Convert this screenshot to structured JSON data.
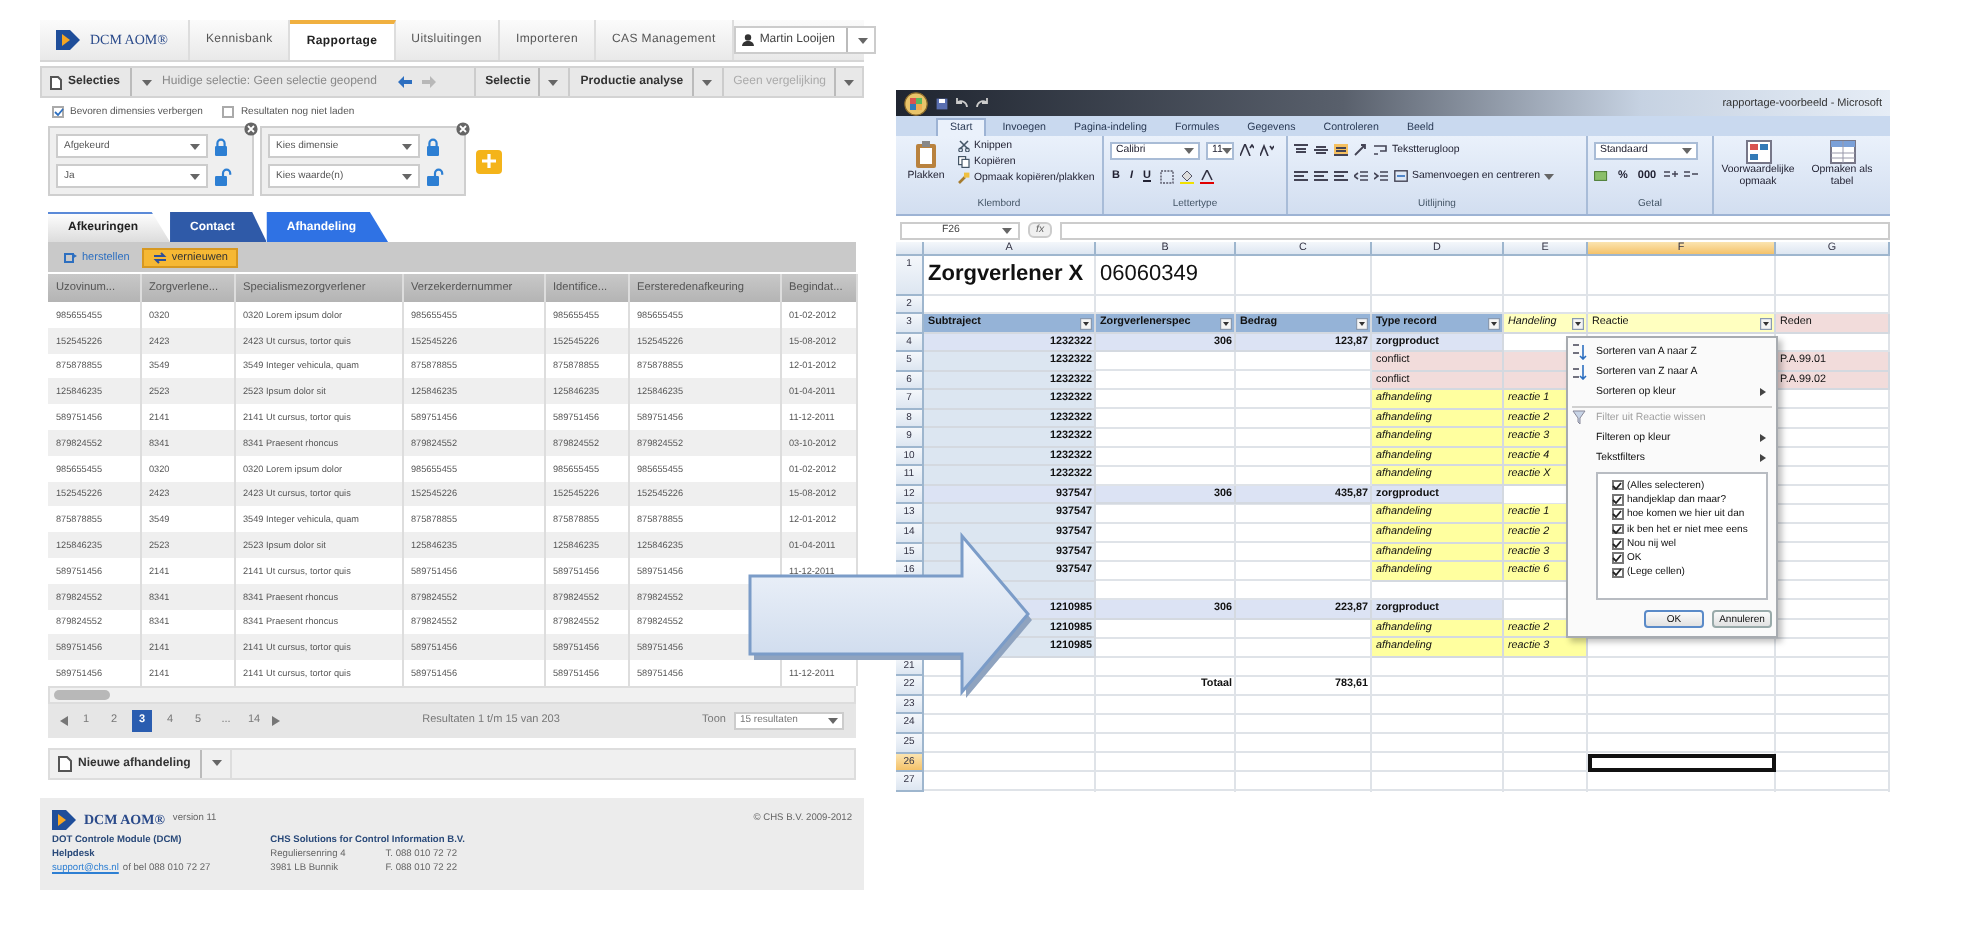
{
  "portal": {
    "logo": {
      "text": "DCM AOM®"
    },
    "nav_tabs": [
      {
        "label": "Kennisbank",
        "selected": false
      },
      {
        "label": "Rapportage",
        "selected": true
      },
      {
        "label": "Uitsluitingen",
        "selected": false
      },
      {
        "label": "Importeren",
        "selected": false
      },
      {
        "label": "CAS Management",
        "selected": false
      }
    ],
    "user_menu": {
      "label": "Martin Looijen"
    },
    "toolbar": {
      "selections_button": "Selecties",
      "current_selection": "Huidige selectie: Geen selectie geopend",
      "menus": [
        {
          "label": "Selectie",
          "disabled": false
        },
        {
          "label": "Productie analyse",
          "disabled": false
        },
        {
          "label": "Geen vergelijking",
          "disabled": true
        }
      ]
    },
    "options": [
      {
        "label": "Bevoren dimensies verbergen",
        "checked": true
      },
      {
        "label": "Resultaten nog niet laden",
        "checked": false
      }
    ],
    "filters": [
      {
        "fields": [
          {
            "text": "Afgekeurd",
            "locked": true
          },
          {
            "text": "Ja",
            "locked": false
          }
        ]
      },
      {
        "fields": [
          {
            "text": "Kies dimensie",
            "locked": true
          },
          {
            "text": "Kies waarde(n)",
            "locked": false
          }
        ]
      }
    ],
    "view_tabs": [
      {
        "label": "Afkeuringen",
        "selected": true
      },
      {
        "label": "Contact",
        "selected": false
      },
      {
        "label": "Afhandeling",
        "selected": false
      }
    ],
    "actions": [
      {
        "label": "herstellen",
        "kind": "link"
      },
      {
        "label": "vernieuwen",
        "kind": "button"
      }
    ],
    "table": {
      "columns": [
        "Uzovinum...",
        "Zorgverlene...",
        "Specialismezorgverlener",
        "Verzekerdernummer",
        "Identifice...",
        "Eersteredenafkeuring",
        "Begindat..."
      ],
      "rows": [
        [
          "985655455",
          "0320",
          "0320 Lorem ipsum dolor",
          "985655455",
          "985655455",
          "985655455",
          "01-02-2012"
        ],
        [
          "152545226",
          "2423",
          "2423 Ut cursus, tortor quis",
          "152545226",
          "152545226",
          "152545226",
          "15-08-2012"
        ],
        [
          "875878855",
          "3549",
          "3549 Integer vehicula, quam",
          "875878855",
          "875878855",
          "875878855",
          "12-01-2012"
        ],
        [
          "125846235",
          "2523",
          "2523 Ipsum dolor sit",
          "125846235",
          "125846235",
          "125846235",
          "01-04-2011"
        ],
        [
          "589751456",
          "2141",
          "2141 Ut cursus, tortor quis",
          "589751456",
          "589751456",
          "589751456",
          "11-12-2011"
        ],
        [
          "879824552",
          "8341",
          "8341 Praesent rhoncus",
          "879824552",
          "879824552",
          "879824552",
          "03-10-2012"
        ],
        [
          "985655455",
          "0320",
          "0320 Lorem ipsum dolor",
          "985655455",
          "985655455",
          "985655455",
          "01-02-2012"
        ],
        [
          "152545226",
          "2423",
          "2423 Ut cursus, tortor quis",
          "152545226",
          "152545226",
          "152545226",
          "15-08-2012"
        ],
        [
          "875878855",
          "3549",
          "3549 Integer vehicula, quam",
          "875878855",
          "875878855",
          "875878855",
          "12-01-2012"
        ],
        [
          "125846235",
          "2523",
          "2523 Ipsum dolor sit",
          "125846235",
          "125846235",
          "125846235",
          "01-04-2011"
        ],
        [
          "589751456",
          "2141",
          "2141 Ut cursus, tortor quis",
          "589751456",
          "589751456",
          "589751456",
          "11-12-2011"
        ],
        [
          "879824552",
          "8341",
          "8341 Praesent rhoncus",
          "879824552",
          "879824552",
          "879824552"
        ],
        [
          "879824552",
          "8341",
          "8341 Praesent rhoncus",
          "879824552",
          "879824552",
          "879824552"
        ],
        [
          "589751456",
          "2141",
          "2141 Ut cursus, tortor quis",
          "589751456",
          "589751456",
          "589751456"
        ],
        [
          "589751456",
          "2141",
          "2141 Ut cursus, tortor quis",
          "589751456",
          "589751456",
          "589751456",
          "11-12-2011"
        ]
      ]
    },
    "pagination": {
      "pages": [
        {
          "label": "1",
          "selected": false
        },
        {
          "label": "2",
          "selected": false
        },
        {
          "label": "3",
          "selected": true
        },
        {
          "label": "4",
          "selected": false
        },
        {
          "label": "5",
          "selected": false
        },
        {
          "label": "...",
          "selected": false
        },
        {
          "label": "14",
          "selected": false
        }
      ],
      "summary": "Resultaten 1 t/m 15 van 203",
      "show_label": "Toon",
      "page_size": "15 resultaten"
    },
    "new_button": {
      "label": "Nieuwe afhandeling"
    },
    "footer": {
      "logo": "DCM AOM®",
      "version": "version 11",
      "copyright": "© CHS B.V. 2009-2012",
      "product": "DOT Controle Module (DCM)",
      "helpdesk": "Helpdesk",
      "email": "support@chs.nl",
      "phone_text": "of bel 088 010 72 27",
      "company": "CHS Solutions for Control Information B.V.",
      "address": [
        "Reguliersenring 4",
        "3981 LB Bunnik"
      ],
      "phones": [
        "T. 088 010 72 72",
        "F. 088 010 72 22"
      ]
    }
  },
  "spreadsheet": {
    "title": "rapportage-voorbeeld - Microsoft",
    "ribbon_tabs": [
      {
        "label": "Start",
        "selected": true
      },
      {
        "label": "Invoegen",
        "selected": false
      },
      {
        "label": "Pagina-indeling",
        "selected": false
      },
      {
        "label": "Formules",
        "selected": false
      },
      {
        "label": "Gegevens",
        "selected": false
      },
      {
        "label": "Controleren",
        "selected": false
      },
      {
        "label": "Beeld",
        "selected": false
      }
    ],
    "clipboard": {
      "paste": "Plakken",
      "commands": [
        "Knippen",
        "Kopiëren",
        "Opmaak kopiëren/plakken"
      ],
      "label": "Klembord"
    },
    "font": {
      "name": "Calibri",
      "size": "11",
      "styles": [
        "B",
        "I",
        "U"
      ],
      "label": "Lettertype"
    },
    "alignment": {
      "wrap": "Tekstterugloop",
      "merge": "Samenvoegen en centreren",
      "label": "Uitlijning"
    },
    "number": {
      "format": "Standaard",
      "buttons": [
        "%",
        "000"
      ],
      "label": "Getal"
    },
    "styles": [
      "Voorwaardelijke opmaak",
      "Opmaken als tabel"
    ],
    "name_box": "F26",
    "function_label": "fx",
    "columns": [
      {
        "label": "A",
        "selected": false
      },
      {
        "label": "B",
        "selected": false
      },
      {
        "label": "C",
        "selected": false
      },
      {
        "label": "D",
        "selected": false
      },
      {
        "label": "E",
        "selected": false
      },
      {
        "label": "F",
        "selected": true
      },
      {
        "label": "G",
        "selected": false
      }
    ],
    "rows": [
      {
        "number": "1",
        "kind": "title",
        "selected": false,
        "cells": {
          "a": "Zorgverlener X",
          "b": "06060349"
        }
      },
      {
        "number": "2",
        "kind": "plain",
        "selected": false
      },
      {
        "number": "3",
        "kind": "header",
        "selected": false,
        "cells": {
          "a": "Subtraject",
          "b": "Zorgverlenerspec",
          "c": "Bedrag",
          "d": "Type record",
          "e": "Handeling",
          "f": "Reactie",
          "g": "Reden"
        }
      },
      {
        "number": "4",
        "kind": "product",
        "selected": false,
        "cells": {
          "a": "1232322",
          "b": "306",
          "c": "123,87",
          "d": "zorgproduct"
        }
      },
      {
        "number": "5",
        "kind": "conflict",
        "selected": false,
        "cells": {
          "a": "1232322",
          "d": "conflict",
          "g": "P.A.99.01"
        }
      },
      {
        "number": "6",
        "kind": "conflict",
        "selected": false,
        "cells": {
          "a": "1232322",
          "d": "conflict",
          "g": "P.A.99.02"
        }
      },
      {
        "number": "7",
        "kind": "handling",
        "selected": false,
        "cells": {
          "a": "1232322",
          "d": "afhandeling",
          "e": "reactie 1"
        }
      },
      {
        "number": "8",
        "kind": "handling",
        "selected": false,
        "cells": {
          "a": "1232322",
          "d": "afhandeling",
          "e": "reactie 2"
        }
      },
      {
        "number": "9",
        "kind": "handling",
        "selected": false,
        "cells": {
          "a": "1232322",
          "d": "afhandeling",
          "e": "reactie 3"
        }
      },
      {
        "number": "10",
        "kind": "handling",
        "selected": false,
        "cells": {
          "a": "1232322",
          "d": "afhandeling",
          "e": "reactie 4"
        }
      },
      {
        "number": "11",
        "kind": "handling",
        "selected": false,
        "cells": {
          "a": "1232322",
          "d": "afhandeling",
          "e": "reactie X"
        }
      },
      {
        "number": "12",
        "kind": "product",
        "selected": false,
        "cells": {
          "a": "937547",
          "b": "306",
          "c": "435,87",
          "d": "zorgproduct"
        }
      },
      {
        "number": "13",
        "kind": "handling",
        "selected": false,
        "cells": {
          "a": "937547",
          "d": "afhandeling",
          "e": "reactie 1"
        }
      },
      {
        "number": "14",
        "kind": "handling",
        "selected": false,
        "cells": {
          "a": "937547",
          "d": "afhandeling",
          "e": "reactie 2"
        }
      },
      {
        "number": "15",
        "kind": "handling",
        "selected": false,
        "cells": {
          "a": "937547",
          "d": "afhandeling",
          "e": "reactie 3"
        }
      },
      {
        "number": "16",
        "kind": "handling",
        "selected": false,
        "cells": {
          "a": "937547",
          "d": "afhandeling",
          "e": "reactie 6"
        }
      },
      {
        "kind": "spacer"
      },
      {
        "kind": "product",
        "cells": {
          "a": "1210985",
          "b": "306",
          "c": "223,87",
          "d": "zorgproduct"
        }
      },
      {
        "kind": "handling",
        "cells": {
          "a": "1210985",
          "d": "afhandeling",
          "e": "reactie 2"
        }
      },
      {
        "kind": "handling",
        "cells": {
          "a": "1210985",
          "d": "afhandeling",
          "e": "reactie 3"
        }
      },
      {
        "number": "21",
        "kind": "plain",
        "selected": false
      },
      {
        "number": "22",
        "kind": "total",
        "selected": false,
        "cells": {
          "b": "Totaal",
          "c": "783,61"
        }
      },
      {
        "number": "23",
        "kind": "plain",
        "selected": false
      },
      {
        "number": "24",
        "kind": "plain",
        "selected": false
      },
      {
        "number": "25",
        "kind": "plain",
        "selected": false
      },
      {
        "number": "26",
        "kind": "plain",
        "selected": true
      },
      {
        "number": "27",
        "kind": "plain",
        "selected": false
      }
    ],
    "filter_menu": {
      "items": [
        {
          "label": "Sorteren van A naar Z",
          "kind": "sort-ascending",
          "disabled": false,
          "submenu": false,
          "divider": false
        },
        {
          "label": "Sorteren van Z naar A",
          "kind": "sort-descending",
          "disabled": false,
          "submenu": false,
          "divider": false
        },
        {
          "label": "Sorteren op kleur",
          "kind": "plain",
          "disabled": false,
          "submenu": true,
          "divider": false
        },
        {
          "label": "Filter uit Reactie wissen",
          "kind": "clear-filter",
          "disabled": true,
          "submenu": false,
          "divider": true
        },
        {
          "label": "Filteren op kleur",
          "kind": "plain",
          "disabled": false,
          "submenu": true,
          "divider": false
        },
        {
          "label": "Tekstfilters",
          "kind": "plain",
          "disabled": false,
          "submenu": true,
          "divider": false
        }
      ],
      "values": [
        {
          "label": "(Alles selecteren)",
          "checked": true
        },
        {
          "label": "handjeklap dan maar?",
          "checked": true
        },
        {
          "label": "hoe komen we hier uit dan",
          "checked": true
        },
        {
          "label": "ik ben het er niet mee eens",
          "checked": true
        },
        {
          "label": "Nou nij wel",
          "checked": true
        },
        {
          "label": "OK",
          "checked": true
        },
        {
          "label": "(Lege cellen)",
          "checked": true
        }
      ],
      "buttons": [
        "OK",
        "Annuleren"
      ]
    }
  }
}
